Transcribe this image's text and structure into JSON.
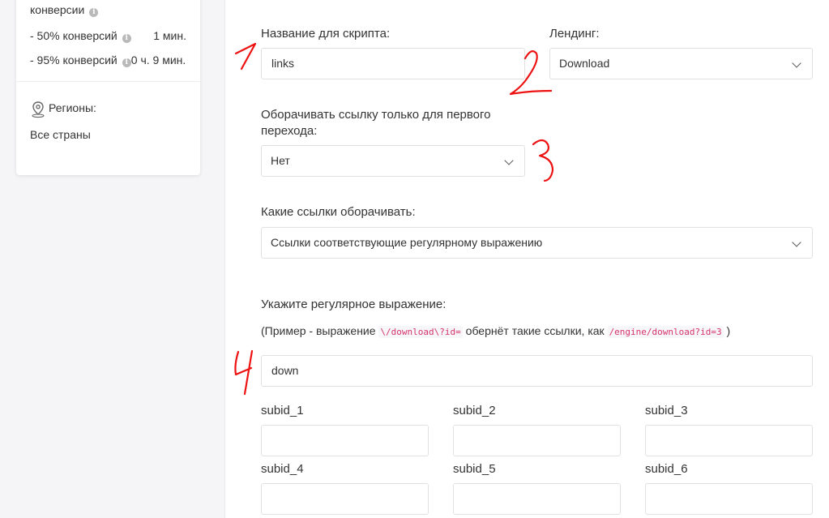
{
  "sidebar": {
    "conversions_label": "конверсии",
    "conv_50_label": "- 50% конверсий",
    "conv_50_value": "1 мин.",
    "conv_95_label": "- 95% конверсий",
    "conv_95_value": "0 ч. 9 мин.",
    "regions_label": "Регионы:",
    "regions_value": "Все страны",
    "info_glyph": "i",
    "location_icon": "map-pin-icon"
  },
  "form": {
    "script_name_label": "Название для скрипта:",
    "script_name_value": "links",
    "landing_label": "Лендинг:",
    "landing_value": "Download",
    "wrap_first_label_line1": "Оборачивать ссылку только для первого",
    "wrap_first_label_line2": "перехода:",
    "wrap_first_value": "Нет",
    "which_links_label": "Какие ссылки оборачивать:",
    "which_links_value": "Ссылки соответствующие регулярному выражению",
    "regex_label": "Укажите регулярное выражение:",
    "hint_prefix": "(Пример - выражение",
    "hint_code1": "\\/download\\?id=",
    "hint_middle": "обернёт такие ссылки, как",
    "hint_code2": "/engine/download?id=3",
    "hint_suffix": ")",
    "regex_value": "down",
    "subids": [
      {
        "label": "subid_1",
        "value": ""
      },
      {
        "label": "subid_2",
        "value": ""
      },
      {
        "label": "subid_3",
        "value": ""
      },
      {
        "label": "subid_4",
        "value": ""
      },
      {
        "label": "subid_5",
        "value": ""
      },
      {
        "label": "subid_6",
        "value": ""
      }
    ]
  },
  "colors": {
    "background": "#f5f5f7",
    "panel": "#ffffff",
    "annotation": "#ee1111",
    "code": "#d6336c"
  }
}
